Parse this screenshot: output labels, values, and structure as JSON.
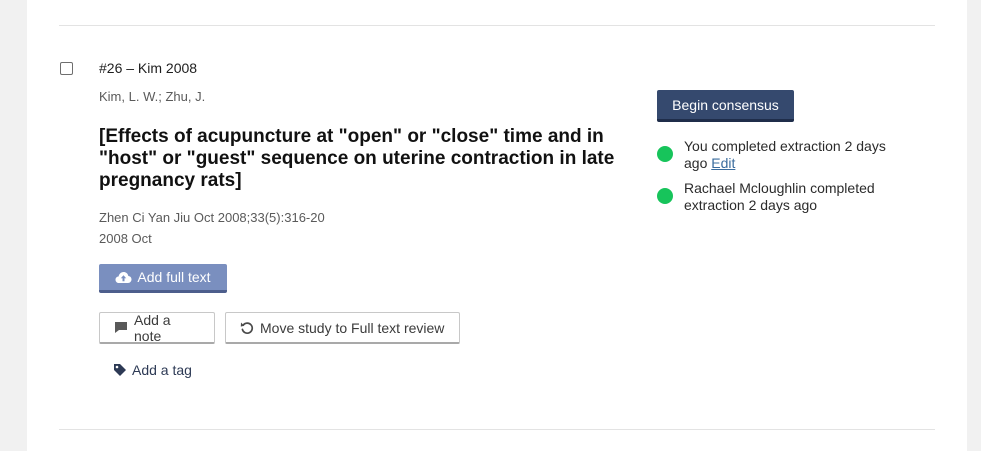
{
  "study": {
    "id_label": "#26 – Kim 2008",
    "authors": "Kim, L. W.; Zhu, J.",
    "title": "[Effects of acupuncture at \"open\" or \"close\" time and in \"host\" or \"guest\" sequence on uterine contraction in late pregnancy rats]",
    "journal": "Zhen Ci Yan Jiu Oct 2008;33(5):316-20",
    "date": "2008 Oct"
  },
  "actions": {
    "add_full_text": "Add full text",
    "add_note": "Add a note",
    "move_study": "Move study to Full text review",
    "add_tag": "Add a tag",
    "begin_consensus": "Begin consensus"
  },
  "status": [
    {
      "text": "You completed extraction 2 days ago",
      "link": "Edit",
      "color": "#17c45b"
    },
    {
      "text": "Rachael Mcloughlin completed extraction 2 days ago",
      "color": "#17c45b"
    }
  ],
  "icons": {
    "full_text": "cloud-upload-icon",
    "note": "comment-icon",
    "move": "undo-icon",
    "tag": "tag-icon"
  },
  "colors": {
    "primary": "#35496e",
    "secondary_button": "#7a8fbf",
    "status_complete": "#17c45b",
    "link": "#3a6c9e"
  }
}
